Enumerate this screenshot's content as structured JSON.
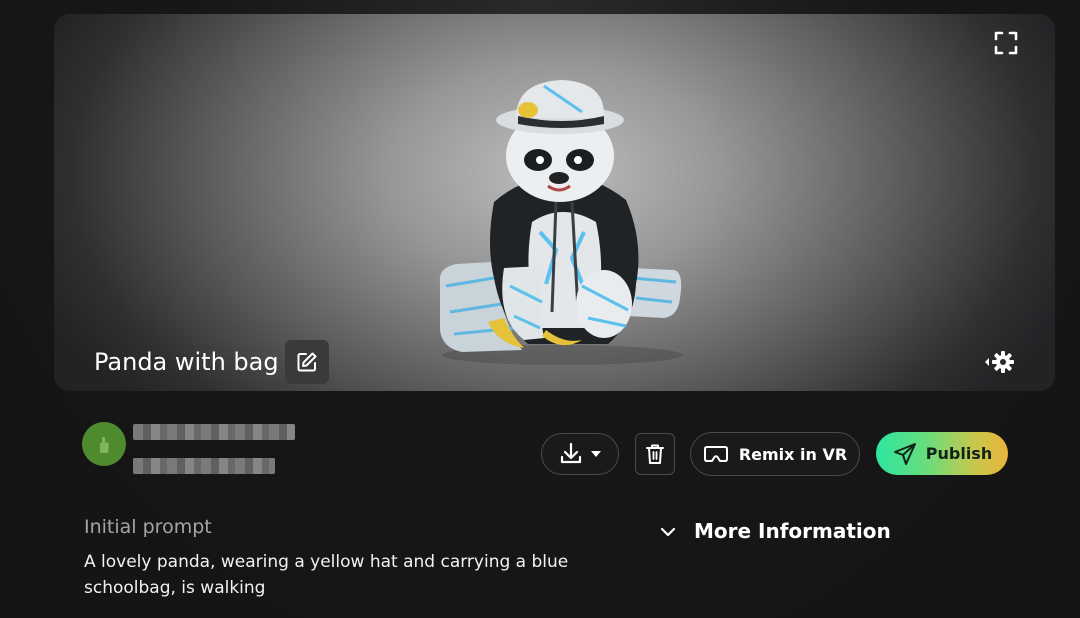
{
  "viewer": {
    "title": "Panda with bag",
    "fullscreen_icon": "fullscreen-icon",
    "edit_icon": "pencil-icon",
    "settings_icon": "gear-icon"
  },
  "actions": {
    "download_icon": "download-icon",
    "delete_icon": "trash-icon",
    "remix_label": "Remix in VR",
    "remix_icon": "vr-headset-icon",
    "publish_label": "Publish",
    "publish_icon": "send-icon"
  },
  "prompt": {
    "heading": "Initial prompt",
    "text": "A lovely panda, wearing a yellow hat and carrying a blue schoolbag, is walking"
  },
  "more_info": {
    "label": "More Information"
  },
  "colors": {
    "publish_gradient_start": "#2de6a0",
    "publish_gradient_end": "#e8b43a",
    "avatar": "#4e8a2e"
  }
}
